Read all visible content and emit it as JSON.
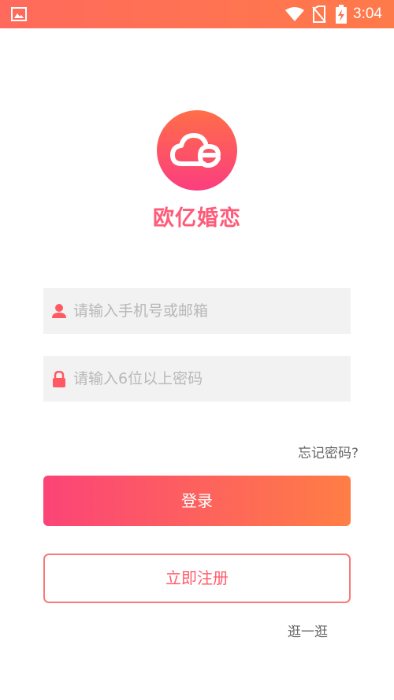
{
  "status_bar": {
    "time": "3:04",
    "icons": [
      "gallery-icon",
      "wifi-icon",
      "no-sim-icon",
      "battery-charging-icon"
    ]
  },
  "brand": {
    "name": "欧亿婚恋",
    "logo_icon": "cloud-e-logo",
    "gradient": [
      "#ff6a50",
      "#fb3f7f"
    ]
  },
  "login_form": {
    "account_placeholder": "请输入手机号或邮箱",
    "password_placeholder": "请输入6位以上密码",
    "forgot_password": "忘记密码?",
    "login_label": "登录",
    "register_label": "立即注册",
    "browse_label": "逛一逛"
  },
  "colors": {
    "accent_start": "#fb4477",
    "accent_end": "#ff7e45",
    "register_border": "#f77a7a"
  }
}
